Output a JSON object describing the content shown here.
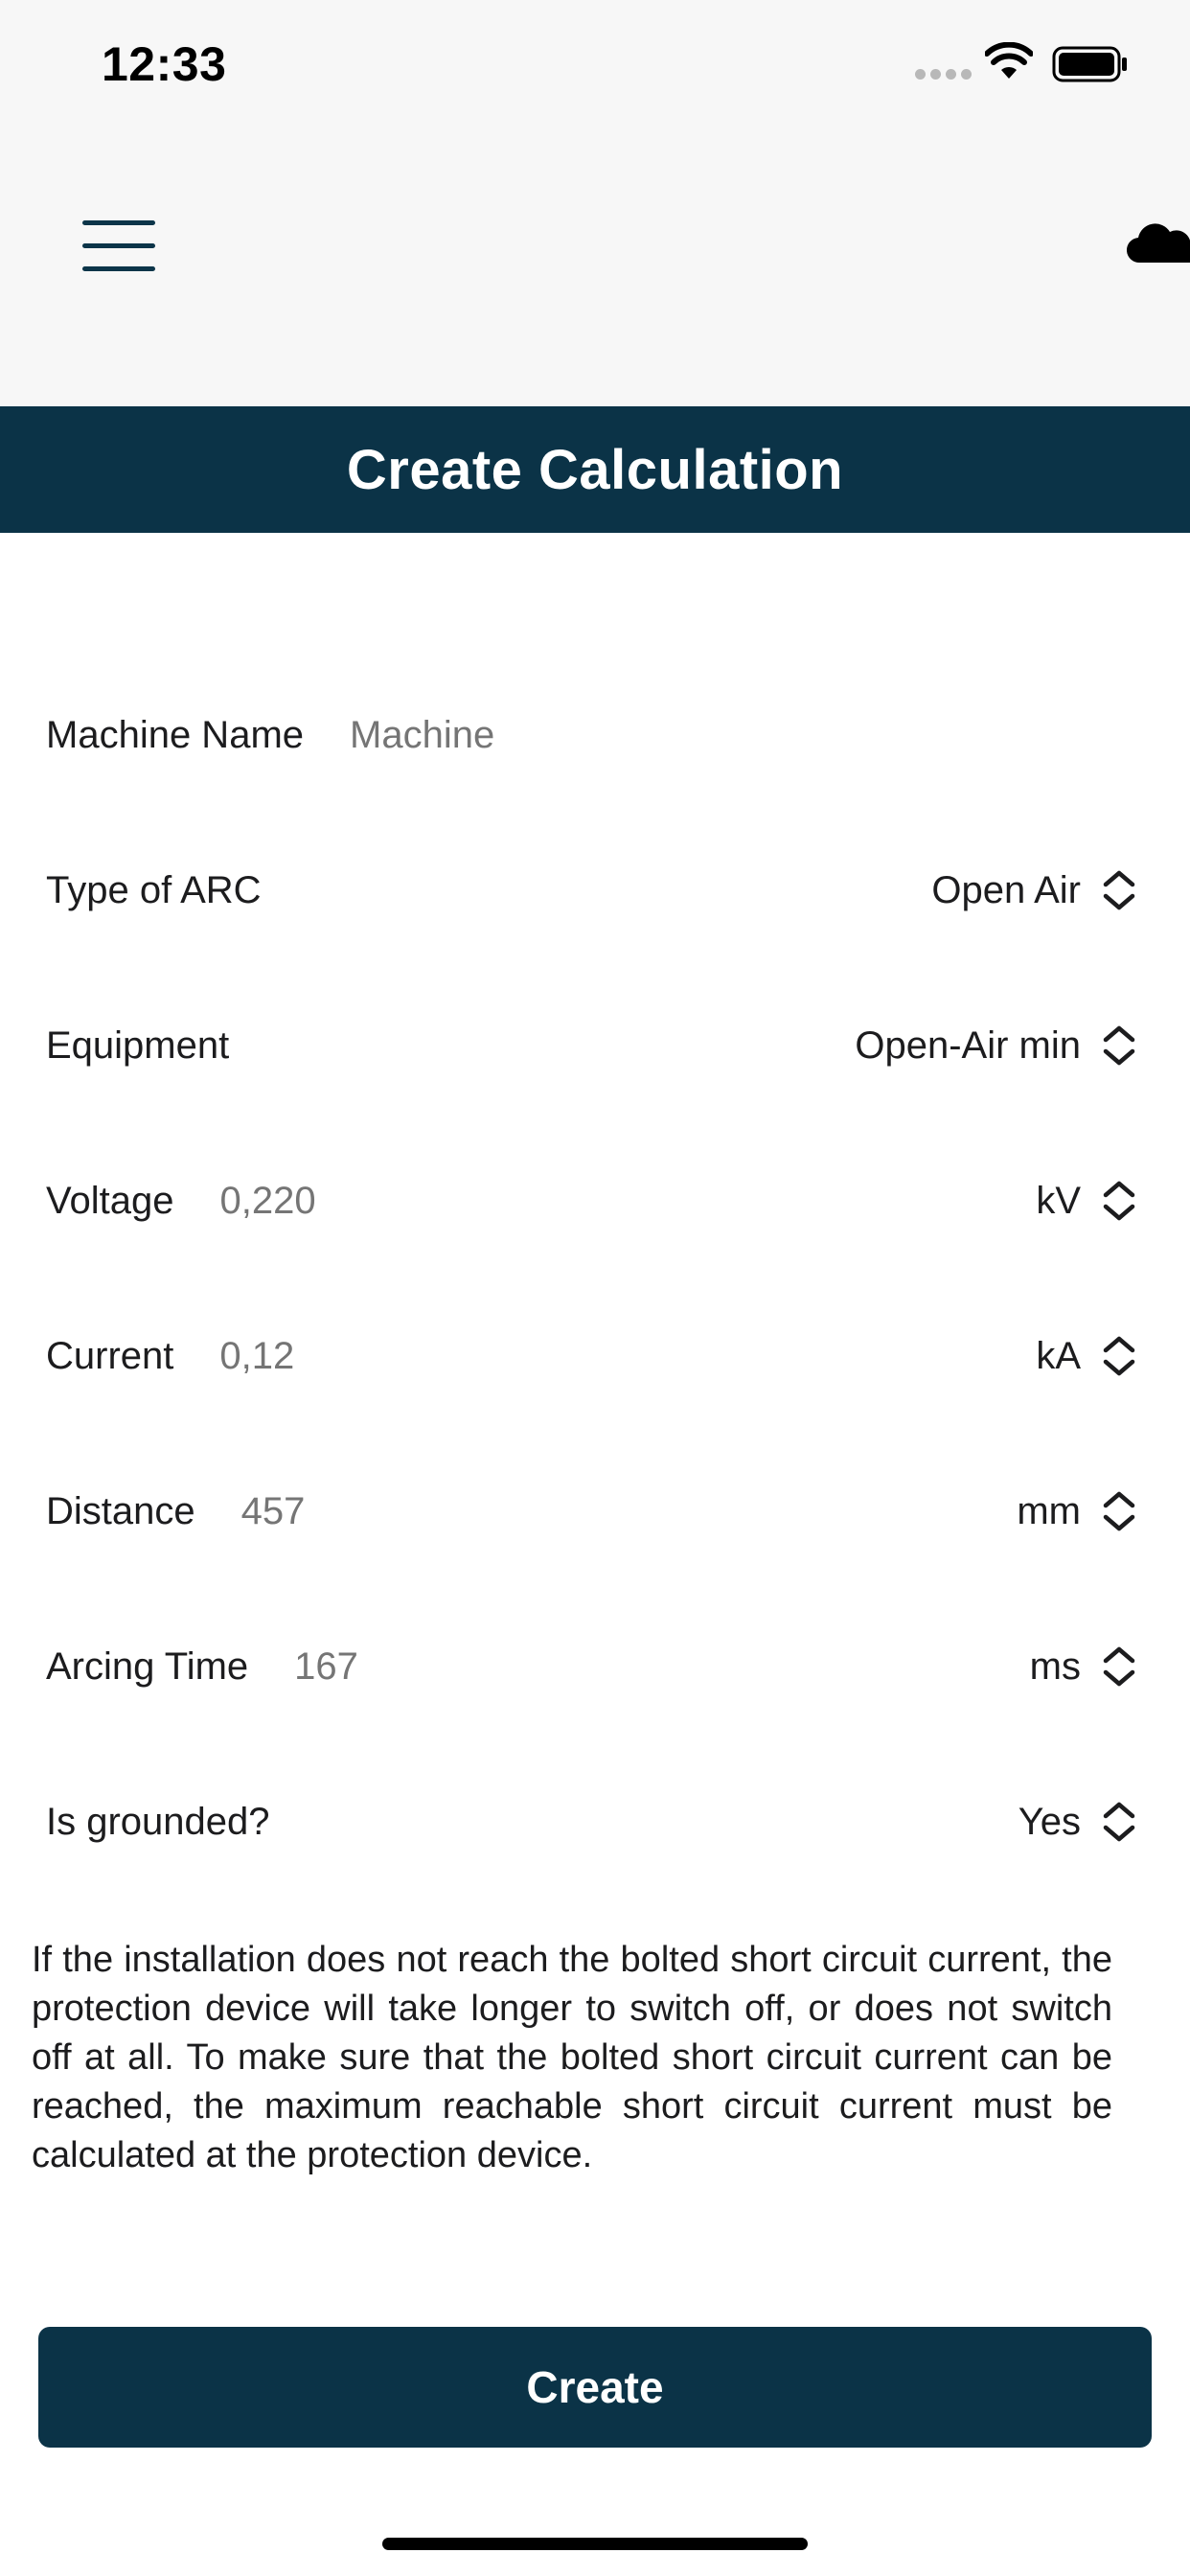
{
  "status_bar": {
    "time": "12:33",
    "icons": [
      "signal-dots-icon",
      "wifi-icon",
      "battery-icon"
    ]
  },
  "nav": {
    "menu_icon": "hamburger-menu-icon",
    "cloud_icon": "cloud-icon"
  },
  "page": {
    "title": "Create Calculation"
  },
  "form": {
    "machine_name": {
      "label": "Machine Name",
      "placeholder": "Machine"
    },
    "arc_type": {
      "label": "Type of ARC",
      "value": "Open Air"
    },
    "equipment": {
      "label": "Equipment",
      "value": "Open-Air min"
    },
    "voltage": {
      "label": "Voltage",
      "placeholder": "0,220",
      "unit": "kV"
    },
    "current": {
      "label": "Current",
      "placeholder": "0,12",
      "unit": "kA"
    },
    "distance": {
      "label": "Distance",
      "placeholder": "457",
      "unit": "mm"
    },
    "arcing_time": {
      "label": "Arcing Time",
      "placeholder": "167",
      "unit": "ms"
    },
    "grounded": {
      "label": "Is grounded?",
      "value": "Yes"
    }
  },
  "notice": "If the installation does not reach the bolted short circuit current, the protection device will take longer to switch off, or does not switch off at all. To make sure that the bolted short circuit current can be reached, the maximum reachable short circuit current must be calculated at the protection device.",
  "actions": {
    "create_label": "Create"
  },
  "colors": {
    "primary": "#0b3347",
    "background": "#ffffff",
    "nav_background": "#f7f7f7",
    "placeholder": "#8a8a8e"
  }
}
